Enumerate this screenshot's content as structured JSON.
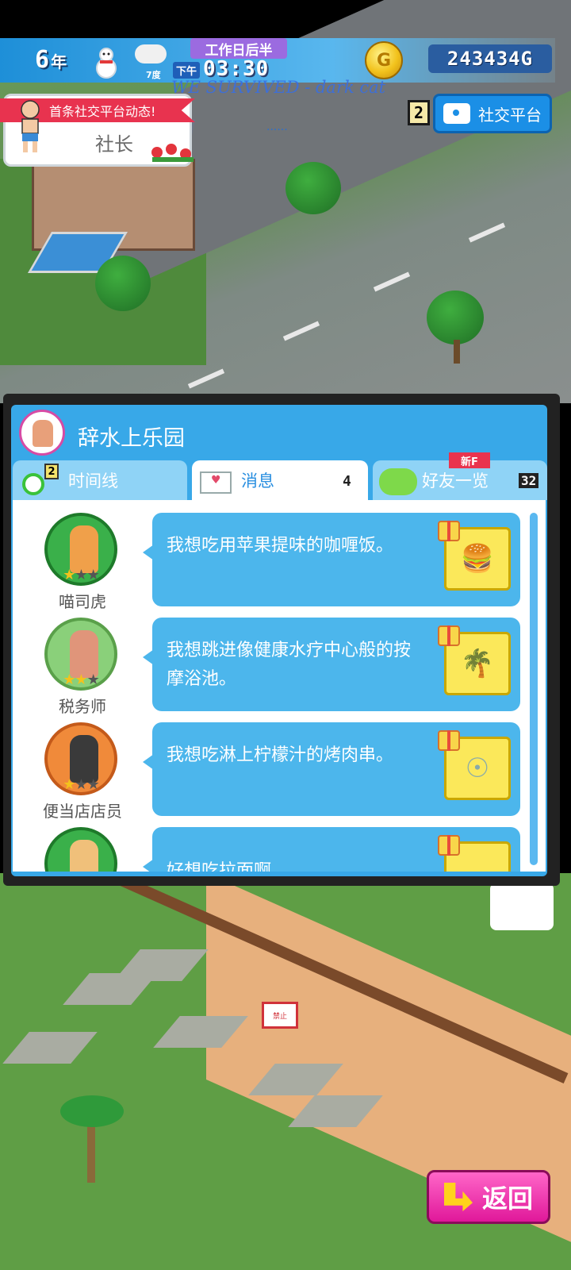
{
  "hud": {
    "year_num": "6",
    "year_unit": "年",
    "temperature": "7度",
    "period": "工作日后半",
    "ampm": "下午",
    "time": "03:30",
    "money": "243434G",
    "coin_symbol": "G",
    "song_overlay": "WE SURVIVED - dark cat"
  },
  "notification": {
    "ribbon": "首条社交平台动态!",
    "name": "社长",
    "dots": "......"
  },
  "social": {
    "count": "2",
    "label": "社交平台"
  },
  "panel": {
    "park_name": "辞水上乐园",
    "tabs": [
      {
        "label": "时间线",
        "badge": "2"
      },
      {
        "label": "消息",
        "count": "4"
      },
      {
        "label": "好友一览",
        "badge": "新F",
        "count": "32"
      }
    ],
    "messages": [
      {
        "name": "喵司虎",
        "stars": [
          "on",
          "off",
          "off"
        ],
        "text": "我想吃用苹果提味的咖喱饭。",
        "item_icon": "burger-icon"
      },
      {
        "name": "税务师",
        "stars": [
          "on",
          "on",
          "off"
        ],
        "text": "我想跳进像健康水疗中心般的按摩浴池。",
        "item_icon": "palm-tree-icon"
      },
      {
        "name": "便当店店员",
        "stars": [
          "on",
          "off",
          "off"
        ],
        "text": "我想吃淋上柠檬汁的烤肉串。",
        "item_icon": "locked-item-icon"
      },
      {
        "name": "",
        "stars": [],
        "text": "好想吃拉面啊",
        "item_icon": "gift-icon"
      }
    ]
  },
  "return_button": {
    "label": "返回"
  },
  "sign_text": "禁止"
}
